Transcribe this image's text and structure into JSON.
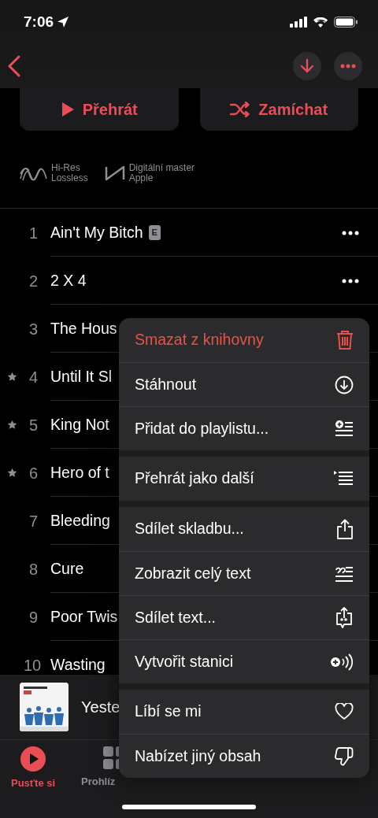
{
  "status_bar": {
    "time": "7:06"
  },
  "actions": [
    {
      "kind": "play",
      "label": "Přehrát"
    },
    {
      "kind": "shuffle",
      "label": "Zamíchat"
    }
  ],
  "quality_badges": [
    {
      "kind": "hires",
      "lines": [
        "Hi-Res",
        "Lossless"
      ]
    },
    {
      "kind": "master",
      "lines": [
        "Digitální master",
        "Apple"
      ]
    }
  ],
  "tracks": [
    {
      "number": "1",
      "title": "Ain't My Bitch",
      "starred": false,
      "explicit": true,
      "more_button": true
    },
    {
      "number": "2",
      "title": "2 X 4",
      "starred": false,
      "explicit": false,
      "more_button": true
    },
    {
      "number": "3",
      "title": "The Hous",
      "starred": false,
      "explicit": false
    },
    {
      "number": "4",
      "title": "Until It Sl",
      "starred": true,
      "explicit": false
    },
    {
      "number": "5",
      "title": "King Not",
      "starred": true,
      "explicit": false
    },
    {
      "number": "6",
      "title": "Hero of t",
      "starred": true,
      "explicit": false
    },
    {
      "number": "7",
      "title": "Bleeding",
      "starred": false,
      "explicit": false
    },
    {
      "number": "8",
      "title": "Cure",
      "starred": false,
      "explicit": false
    },
    {
      "number": "9",
      "title": "Poor Twis",
      "starred": false,
      "explicit": false
    },
    {
      "number": "10",
      "title": "Wasting",
      "starred": false,
      "explicit": false
    }
  ],
  "explicit_badge": "E",
  "now_playing": {
    "title": "Yeste"
  },
  "tab_bar": [
    {
      "label": "Pusťte si",
      "selected": true
    },
    {
      "label": "Prohlíz",
      "selected": false
    }
  ],
  "context_menu": [
    [
      {
        "label": "Smazat z knihovny",
        "destructive": true
      },
      {
        "label": "Stáhnout",
        "destructive": false
      },
      {
        "label": "Přidat do playlistu...",
        "destructive": false
      }
    ],
    [
      {
        "label": "Přehrát jako další",
        "destructive": false
      }
    ],
    [
      {
        "label": "Sdílet skladbu...",
        "destructive": false
      },
      {
        "label": "Zobrazit celý text",
        "destructive": false
      },
      {
        "label": "Sdílet text...",
        "destructive": false
      },
      {
        "label": "Vytvořit stanici",
        "destructive": false
      }
    ],
    [
      {
        "label": "Líbí se mi",
        "destructive": false
      },
      {
        "label": "Nabízet jiný obsah",
        "destructive": false
      }
    ]
  ]
}
